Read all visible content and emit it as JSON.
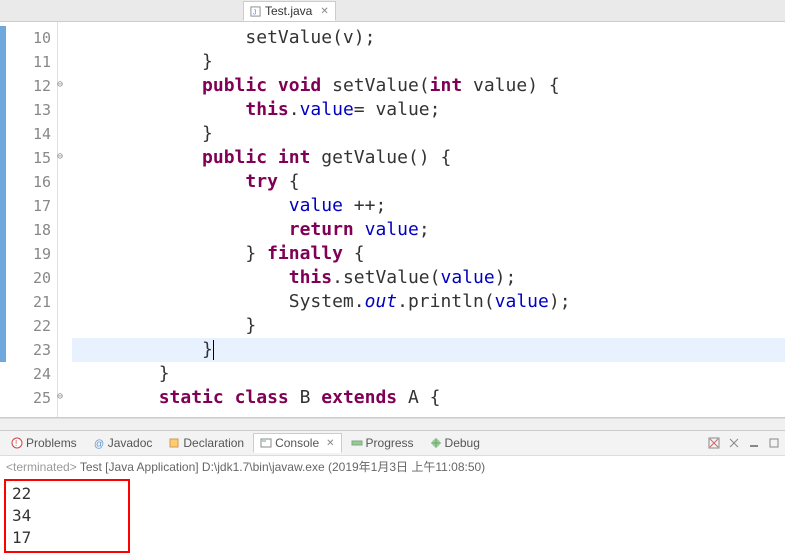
{
  "tabs": {
    "active": {
      "label": "Test.java"
    }
  },
  "editor": {
    "lines": [
      {
        "num": "10",
        "fold": "",
        "tokens": [
          [
            "",
            "                setValue(v);"
          ]
        ]
      },
      {
        "num": "11",
        "fold": "",
        "tokens": [
          [
            "",
            "            }"
          ]
        ]
      },
      {
        "num": "12",
        "fold": "⊖",
        "tokens": [
          [
            "",
            "            "
          ],
          [
            "kw",
            "public"
          ],
          [
            "",
            " "
          ],
          [
            "kw",
            "void"
          ],
          [
            "",
            " setValue("
          ],
          [
            "kw",
            "int"
          ],
          [
            "",
            " value) {"
          ]
        ]
      },
      {
        "num": "13",
        "fold": "",
        "tokens": [
          [
            "",
            "                "
          ],
          [
            "kw",
            "this"
          ],
          [
            "",
            "."
          ],
          [
            "field",
            "value"
          ],
          [
            "",
            "= value;"
          ]
        ]
      },
      {
        "num": "14",
        "fold": "",
        "tokens": [
          [
            "",
            "            }"
          ]
        ]
      },
      {
        "num": "15",
        "fold": "⊖",
        "tokens": [
          [
            "",
            "            "
          ],
          [
            "kw",
            "public"
          ],
          [
            "",
            " "
          ],
          [
            "kw",
            "int"
          ],
          [
            "",
            " getValue() {"
          ]
        ]
      },
      {
        "num": "16",
        "fold": "",
        "tokens": [
          [
            "",
            "                "
          ],
          [
            "kw",
            "try"
          ],
          [
            "",
            " {"
          ]
        ]
      },
      {
        "num": "17",
        "fold": "",
        "tokens": [
          [
            "",
            "                    "
          ],
          [
            "field",
            "value"
          ],
          [
            "",
            " ++;"
          ]
        ]
      },
      {
        "num": "18",
        "fold": "",
        "tokens": [
          [
            "",
            "                    "
          ],
          [
            "kw",
            "return"
          ],
          [
            "",
            " "
          ],
          [
            "field",
            "value"
          ],
          [
            "",
            ";"
          ]
        ]
      },
      {
        "num": "19",
        "fold": "",
        "tokens": [
          [
            "",
            "                } "
          ],
          [
            "kw",
            "finally"
          ],
          [
            "",
            " {"
          ]
        ]
      },
      {
        "num": "20",
        "fold": "",
        "tokens": [
          [
            "",
            "                    "
          ],
          [
            "kw",
            "this"
          ],
          [
            "",
            ".setValue("
          ],
          [
            "field",
            "value"
          ],
          [
            "",
            ");"
          ]
        ]
      },
      {
        "num": "21",
        "fold": "",
        "tokens": [
          [
            "",
            "                    System."
          ],
          [
            "sys-out",
            "out"
          ],
          [
            "",
            ".println("
          ],
          [
            "field",
            "value"
          ],
          [
            "",
            ");"
          ]
        ]
      },
      {
        "num": "22",
        "fold": "",
        "tokens": [
          [
            "",
            "                }"
          ]
        ]
      },
      {
        "num": "23",
        "fold": "",
        "highlight": true,
        "tokens": [
          [
            "",
            "            }"
          ]
        ],
        "caret": true
      },
      {
        "num": "24",
        "fold": "",
        "tokens": [
          [
            "",
            "        }"
          ]
        ]
      },
      {
        "num": "25",
        "fold": "⊖",
        "tokens": [
          [
            "",
            "        "
          ],
          [
            "kw",
            "static"
          ],
          [
            "",
            " "
          ],
          [
            "kw",
            "class"
          ],
          [
            "",
            " B "
          ],
          [
            "kw",
            "extends"
          ],
          [
            "",
            " A {"
          ]
        ]
      }
    ]
  },
  "views": {
    "items": [
      {
        "name": "problems",
        "label": "Problems"
      },
      {
        "name": "javadoc",
        "label": "Javadoc"
      },
      {
        "name": "declaration",
        "label": "Declaration"
      },
      {
        "name": "console",
        "label": "Console",
        "active": true
      },
      {
        "name": "progress",
        "label": "Progress"
      },
      {
        "name": "debug",
        "label": "Debug"
      }
    ]
  },
  "console": {
    "status_prefix": "<terminated>",
    "status": "Test [Java Application] D:\\jdk1.7\\bin\\javaw.exe (2019年1月3日 上午11:08:50)",
    "output": [
      "22",
      "34",
      "17"
    ]
  }
}
